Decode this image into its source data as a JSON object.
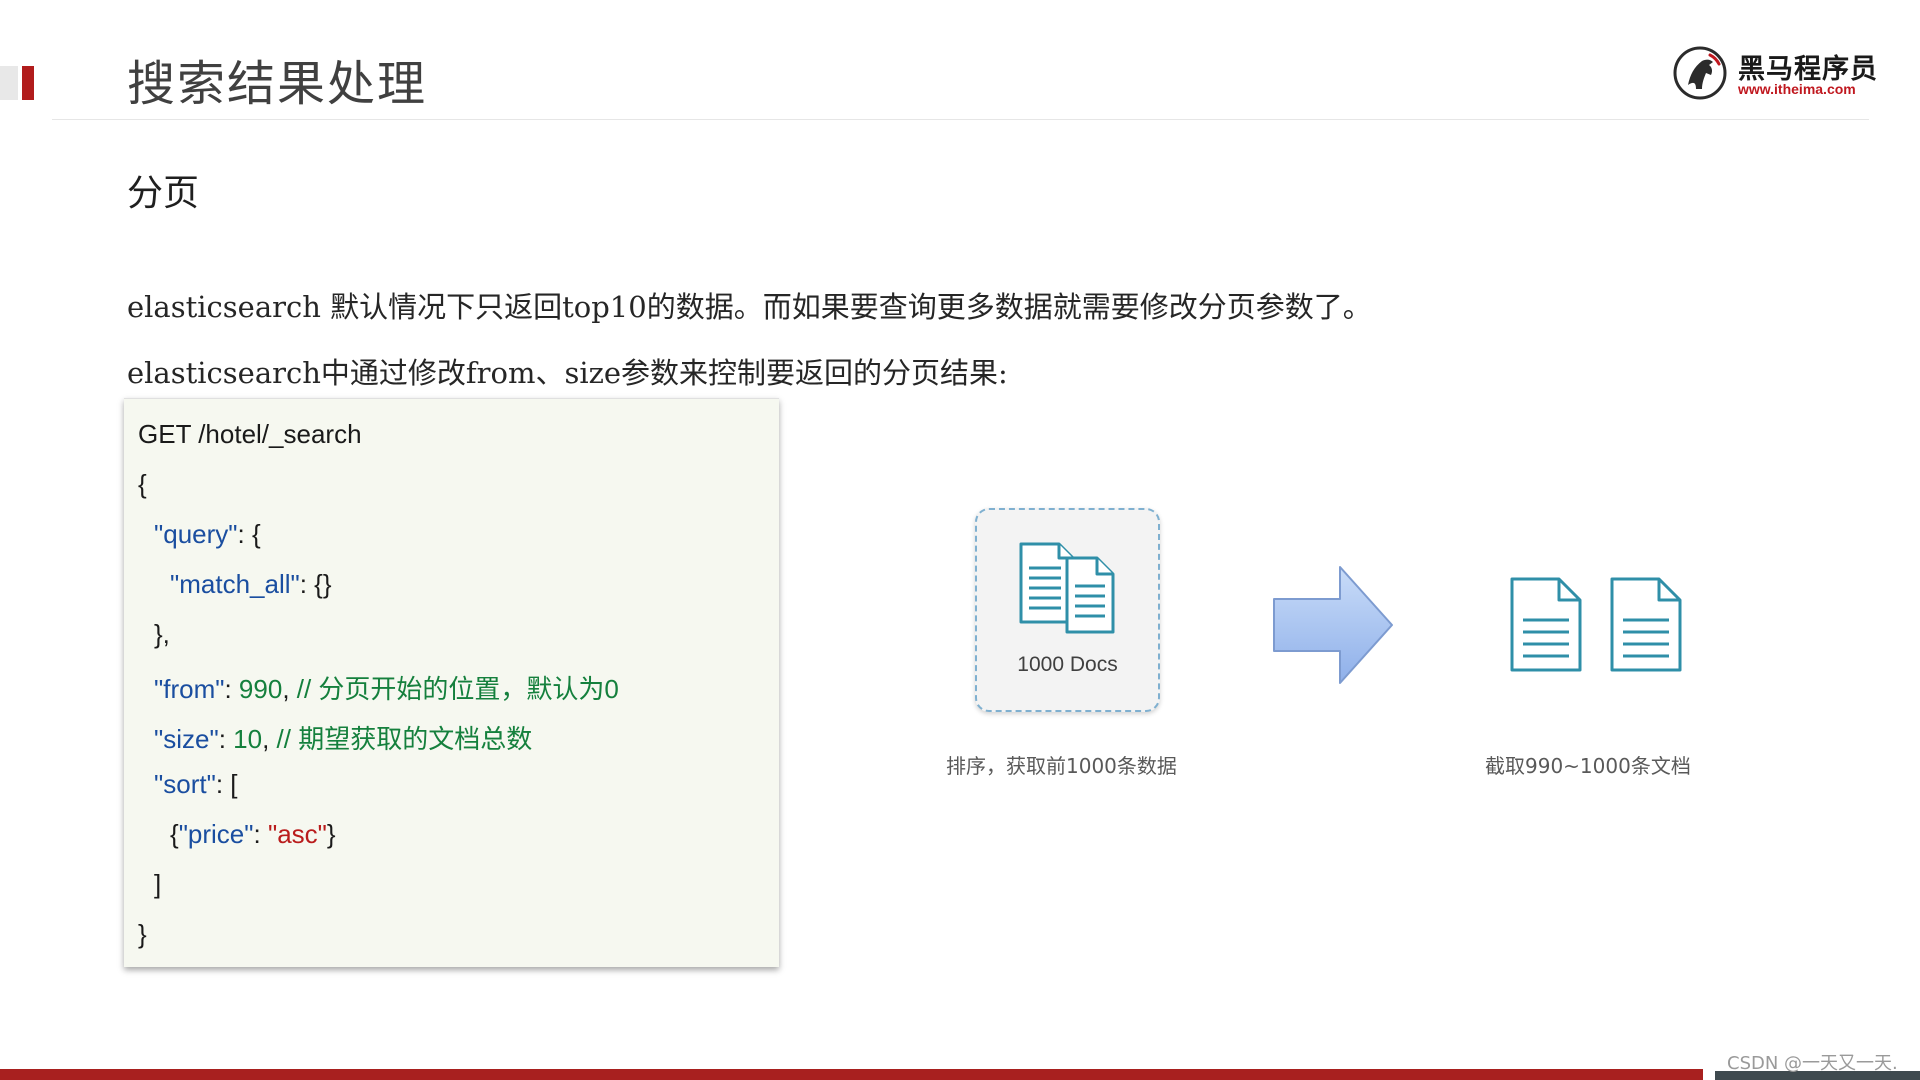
{
  "slide": {
    "title": "搜索结果处理",
    "section_heading": "分页",
    "paragraph_1": "elasticsearch 默认情况下只返回top10的数据。而如果要查询更多数据就需要修改分页参数了。",
    "paragraph_2": "elasticsearch中通过修改from、size参数来控制要返回的分页结果:"
  },
  "logo": {
    "name": "黑马程序员",
    "url": "www.itheima.com",
    "icon": "horse-head-logo"
  },
  "code": {
    "line_1": "GET /hotel/_search",
    "line_2": "{",
    "query_key": "\"query\"",
    "query_open": ": {",
    "match_all_key": "\"match_all\"",
    "match_all_val": ": {}",
    "line_close_query": "},",
    "from_key": "\"from\"",
    "from_colon": ": ",
    "from_value": "990",
    "from_comma": ", ",
    "from_comment": "// 分页开始的位置，默认为0",
    "size_key": "\"size\"",
    "size_colon": ": ",
    "size_value": "10",
    "size_comma": ", ",
    "size_comment": "// 期望获取的文档总数",
    "sort_key": "\"sort\"",
    "sort_open": ": [",
    "price_open": "{",
    "price_key": "\"price\"",
    "price_colon": ": ",
    "price_value": "\"asc\"",
    "price_close": "}",
    "sort_close": "]",
    "line_last": "}"
  },
  "diagram": {
    "card_label": "1000 Docs",
    "caption_left": "排序，获取前1000条数据",
    "caption_right": "截取990~1000条文档",
    "colors": {
      "doc_stroke": "#2f8fa8",
      "arrow_fill": "#a9c4f0",
      "card_border": "#7fb0d0"
    },
    "icons": [
      "documents-stack-icon",
      "right-arrow-icon",
      "document-icon"
    ]
  },
  "footer": {
    "watermark": "CSDN @一天又一天."
  }
}
